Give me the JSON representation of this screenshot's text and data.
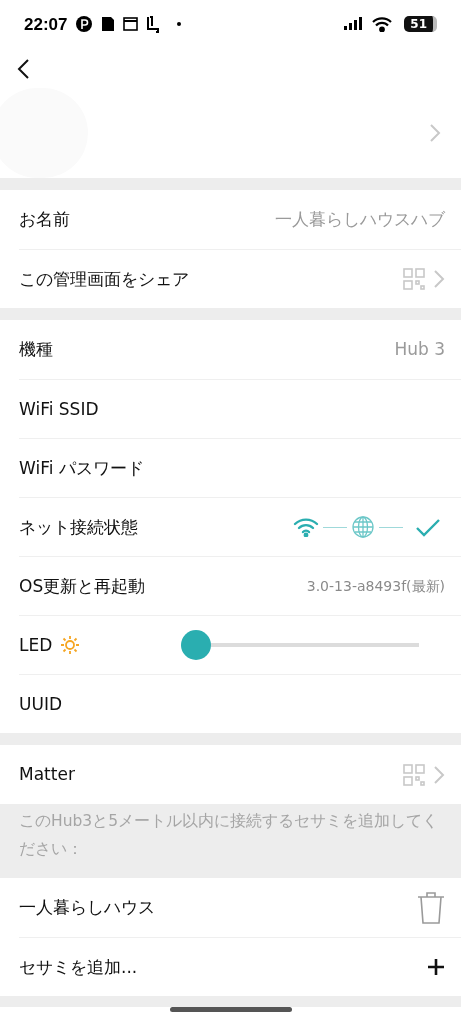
{
  "status_bar": {
    "time": "22:07",
    "battery": "51"
  },
  "sections": [
    {
      "rows": [
        {
          "kind": "text",
          "label": "お名前",
          "value": "一人暮らしハウスハブ"
        },
        {
          "kind": "qr",
          "label": "この管理画面をシェア"
        }
      ]
    },
    {
      "rows": [
        {
          "kind": "text",
          "label": "機種",
          "value": "Hub 3"
        },
        {
          "kind": "blank",
          "label": "WiFi SSID"
        },
        {
          "kind": "blank",
          "label": "WiFi パスワード"
        },
        {
          "kind": "network",
          "label": "ネット接続状態"
        },
        {
          "kind": "small",
          "label": "OS更新と再起動",
          "value": "3.0-13-a8493f(最新)"
        },
        {
          "kind": "slider",
          "label": "LED",
          "level": 0
        },
        {
          "kind": "blank",
          "label": "UUID"
        }
      ]
    },
    {
      "rows": [
        {
          "kind": "qr",
          "label": "Matter"
        }
      ],
      "note": "このHub3と5メートル以内に接続するセサミを追加してください："
    },
    {
      "rows": [
        {
          "kind": "trash",
          "label": "一人暮らしハウス"
        },
        {
          "kind": "plus",
          "label": "セサミを追加..."
        }
      ]
    }
  ]
}
